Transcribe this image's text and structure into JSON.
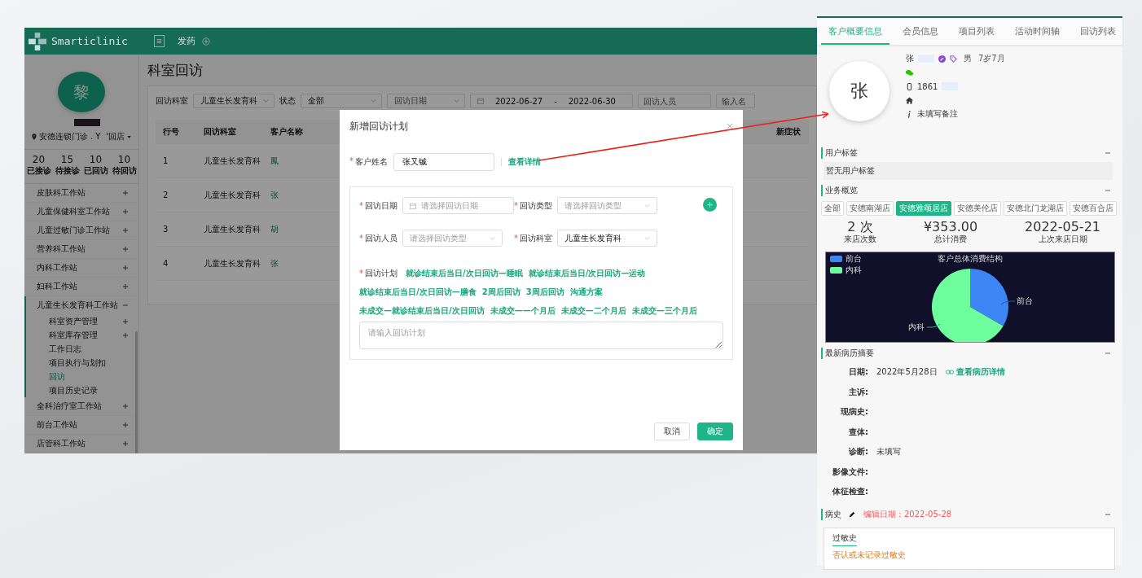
{
  "app": {
    "brand": "Smarticlinic",
    "top_link": "发药"
  },
  "sidebar": {
    "avatar": "黎",
    "location": "安德连锁门诊 . Y",
    "store": "'回店",
    "stats": [
      {
        "value": "20",
        "label": "已接诊"
      },
      {
        "value": "15",
        "label": "待接诊"
      },
      {
        "value": "10",
        "label": "已回访"
      },
      {
        "value": "10",
        "label": "待回访"
      }
    ],
    "menu": [
      {
        "label": "皮肤科工作站",
        "expanded": false
      },
      {
        "label": "儿童保健科室工作站",
        "expanded": false
      },
      {
        "label": "儿童过敏门诊工作站",
        "expanded": false
      },
      {
        "label": "营养科工作站",
        "expanded": false
      },
      {
        "label": "内科工作站",
        "expanded": false
      },
      {
        "label": "妇科工作站",
        "expanded": false
      },
      {
        "label": "儿童生长发育科工作站",
        "expanded": true,
        "children": [
          {
            "kind": "group",
            "label": "科室资产管理",
            "expanded": false,
            "selected": false
          },
          {
            "kind": "group",
            "label": "科室库存管理",
            "expanded": false,
            "selected": false
          },
          {
            "kind": "link",
            "label": "工作日志",
            "selected": false
          },
          {
            "kind": "link",
            "label": "项目执行与划扣",
            "selected": false
          },
          {
            "kind": "link",
            "label": "回访",
            "selected": true
          },
          {
            "kind": "link",
            "label": "项目历史记录",
            "selected": false
          }
        ]
      },
      {
        "label": "全科治疗室工作站",
        "expanded": false
      },
      {
        "label": "前台工作站",
        "expanded": false
      },
      {
        "label": "店管科工作站",
        "expanded": false
      }
    ]
  },
  "page": {
    "title": "科室回访",
    "filters": [
      {
        "kind": "select",
        "label": "回访科室",
        "value": "儿童生长发育科"
      },
      {
        "kind": "select",
        "label": "状态",
        "value": "全部"
      },
      {
        "kind": "select",
        "placeholder": "回访日期"
      },
      {
        "kind": "daterange",
        "start": "2022-06-27",
        "separator": "-",
        "end": "2022-06-30"
      },
      {
        "kind": "input",
        "placeholder": "回访人员"
      },
      {
        "kind": "input",
        "placeholder": "输入名"
      }
    ]
  },
  "table": {
    "columns": [
      "行号",
      "回访科室",
      "客户名称"
    ],
    "last_column": "新症状",
    "rows": [
      {
        "cells": [
          "1",
          "儿童生长发育科",
          "鳳"
        ]
      },
      {
        "cells": [
          "2",
          "儿童生长发育科",
          "张"
        ]
      },
      {
        "cells": [
          "3",
          "儿童生长发育科",
          "胡"
        ]
      },
      {
        "cells": [
          "4",
          "儿童生长发育科",
          "张"
        ]
      }
    ]
  },
  "modal": {
    "title": "新增回访计划",
    "customer": {
      "label": "客户姓名",
      "required": true,
      "value": "张又铖",
      "link": "查看详情"
    },
    "fields": [
      {
        "kind": "date",
        "label": "回访日期",
        "required": true,
        "placeholder": "请选择回访日期"
      },
      {
        "kind": "select",
        "label": "回访类型",
        "required": true,
        "placeholder": "请选择回访类型"
      },
      {
        "kind": "select",
        "label": "回访人员",
        "required": true,
        "placeholder": "请选择回访类型"
      },
      {
        "kind": "select",
        "label": "回访科室",
        "required": true,
        "value": "儿童生长发育科"
      }
    ],
    "plan": {
      "label": "回访计划",
      "required": true,
      "placeholder": "请输入回访计划",
      "options": [
        "就诊结束后当日/次日回访—睡眠",
        "就诊结束后当日/次日回访—运动",
        "就诊结束后当日/次日回访—膳食",
        "2周后回访",
        "3周后回访",
        "沟通方案",
        "未成交—就诊结束后当日/次日回访",
        "未成交——个月后",
        "未成交—二个月后",
        "未成交—三个月后"
      ]
    },
    "buttons": [
      {
        "kind": "default",
        "label": "取消"
      },
      {
        "kind": "primary",
        "label": "确定"
      }
    ]
  },
  "panel": {
    "tabs": [
      {
        "label": "客户概要信息",
        "selected": true
      },
      {
        "label": "会员信息",
        "selected": false
      },
      {
        "label": "项目列表",
        "selected": false
      },
      {
        "label": "活动时间轴",
        "selected": false
      },
      {
        "label": "回访列表",
        "selected": false
      }
    ],
    "avatar": "张",
    "name": "张",
    "gender": "男",
    "age": "7岁7月",
    "phone": "1861",
    "note": "未填写备注",
    "tags_section": {
      "title": "用户标签",
      "empty": "暂无用户标签"
    },
    "business": {
      "title": "业务概览",
      "stores": [
        {
          "label": "全部",
          "selected": false
        },
        {
          "label": "安德南湖店",
          "selected": false
        },
        {
          "label": "安德雅颂居店",
          "selected": true
        },
        {
          "label": "安德美伦店",
          "selected": false
        },
        {
          "label": "安德北门龙湖店",
          "selected": false
        },
        {
          "label": "安德百合店",
          "selected": false
        }
      ],
      "stats": [
        {
          "value": "2 次",
          "label": "来店次数"
        },
        {
          "value": "¥353.00",
          "label": "总计消费"
        },
        {
          "value": "2022-05-21",
          "label": "上次来店日期"
        }
      ],
      "chart": {
        "title": "客户总体消费结构",
        "legend": [
          {
            "label": "前台",
            "color": "#3d86f5"
          },
          {
            "label": "内科",
            "color": "#6dfd9d"
          }
        ],
        "slice_labels": [
          "前台",
          "内科"
        ]
      }
    },
    "record": {
      "title": "最新病历摘要",
      "date_label": "日期:",
      "date": "2022年5月28日",
      "link": "查看病历详情",
      "rows": [
        {
          "label": "主诉:"
        },
        {
          "label": "现病史:"
        },
        {
          "label": "查体:"
        },
        {
          "label": "诊断:",
          "value": "未填写"
        },
        {
          "label": "影像文件:"
        },
        {
          "label": "体征检查:"
        }
      ]
    },
    "history": {
      "title": "病史",
      "edit_date": "编辑日期：2022-05-28",
      "tab": "过敏史",
      "text": "否认或未记录过敏史"
    }
  }
}
